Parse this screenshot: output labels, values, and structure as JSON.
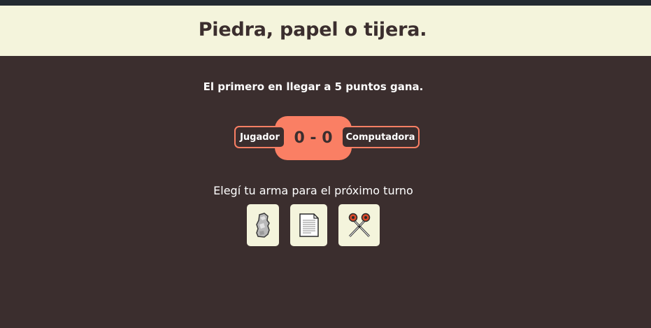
{
  "header": {
    "title": "Piedra, papel o tijera."
  },
  "rules_text": "El primero en llegar a 5 puntos gana.",
  "scoreboard": {
    "player_label": "Jugador",
    "computer_label": "Computadora",
    "score": "0 - 0",
    "player_score": 0,
    "computer_score": 0
  },
  "prompt": "Elegí tu arma para el próximo turno",
  "weapons": [
    {
      "id": "rock",
      "icon": "rock-icon"
    },
    {
      "id": "paper",
      "icon": "paper-icon"
    },
    {
      "id": "scissors",
      "icon": "scissors-icon"
    }
  ],
  "colors": {
    "background": "#3b2e2e",
    "header_bg": "#f4f4dc",
    "accent": "#fa7f64",
    "top_bar": "#232a31"
  }
}
